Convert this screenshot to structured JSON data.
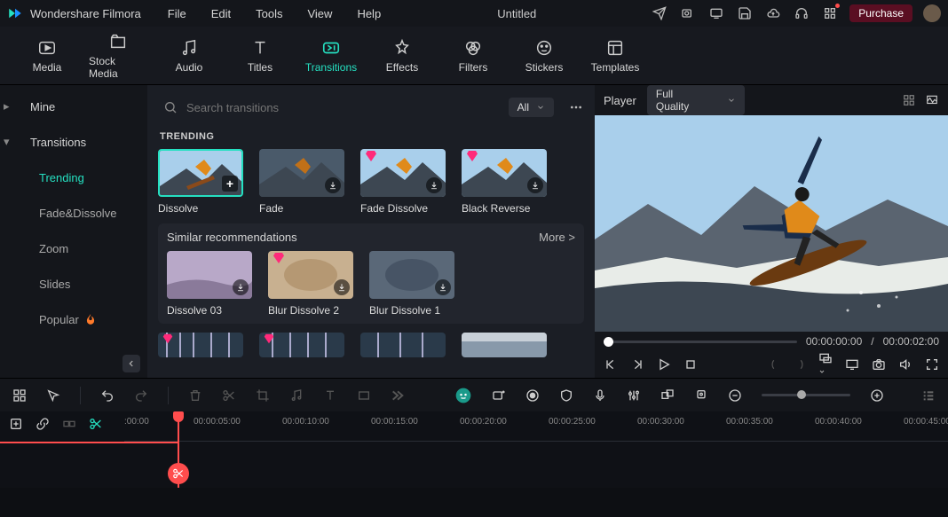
{
  "app": {
    "name": "Wondershare Filmora",
    "doc_title": "Untitled"
  },
  "menu": [
    "File",
    "Edit",
    "Tools",
    "View",
    "Help"
  ],
  "purchase_label": "Purchase",
  "tabs": [
    {
      "label": "Media",
      "icon": "media-icon"
    },
    {
      "label": "Stock Media",
      "icon": "stock-icon"
    },
    {
      "label": "Audio",
      "icon": "audio-icon"
    },
    {
      "label": "Titles",
      "icon": "titles-icon"
    },
    {
      "label": "Transitions",
      "icon": "transitions-icon",
      "active": true
    },
    {
      "label": "Effects",
      "icon": "effects-icon"
    },
    {
      "label": "Filters",
      "icon": "filters-icon"
    },
    {
      "label": "Stickers",
      "icon": "stickers-icon"
    },
    {
      "label": "Templates",
      "icon": "templates-icon"
    }
  ],
  "leftnav": {
    "mine": "Mine",
    "transitions": "Transitions",
    "subs": [
      "Trending",
      "Fade&Dissolve",
      "Zoom",
      "Slides",
      "Popular"
    ],
    "active_index": 0
  },
  "search": {
    "placeholder": "Search transitions",
    "filter_label": "All"
  },
  "sections": {
    "trending_title": "TRENDING",
    "trending": [
      {
        "label": "Dissolve",
        "selected": true,
        "premium": false,
        "icon": "add"
      },
      {
        "label": "Fade",
        "premium": false,
        "icon": "dl"
      },
      {
        "label": "Fade Dissolve",
        "premium": true,
        "icon": "dl"
      },
      {
        "label": "Black Reverse",
        "premium": true,
        "icon": "dl"
      }
    ],
    "similar_title": "Similar recommendations",
    "more_label": "More >",
    "similar": [
      {
        "label": "Dissolve 03",
        "premium": false
      },
      {
        "label": "Blur Dissolve 2",
        "premium": true
      },
      {
        "label": "Blur Dissolve 1",
        "premium": false
      }
    ],
    "bottom_premium": [
      true,
      true,
      false,
      false
    ]
  },
  "player": {
    "label": "Player",
    "quality": "Full Quality",
    "current": "00:00:00:00",
    "sep": "/",
    "total": "00:00:02:00"
  },
  "timeline": {
    "ticks": [
      ":00:00",
      "00:00:05:00",
      "00:00:10:00",
      "00:00:15:00",
      "00:00:20:00",
      "00:00:25:00",
      "00:00:30:00",
      "00:00:35:00",
      "00:00:40:00",
      "00:00:45:00"
    ]
  }
}
